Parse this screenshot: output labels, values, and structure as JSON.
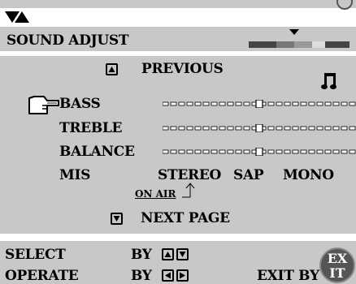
{
  "header": {
    "title": "SOUND ADJUST"
  },
  "menu": {
    "previous_label": "PREVIOUS",
    "next_label": "NEXT PAGE",
    "items": [
      {
        "label": "BASS"
      },
      {
        "label": "TREBLE"
      },
      {
        "label": "BALANCE"
      },
      {
        "label": "MIS"
      }
    ],
    "mis_options": [
      "STEREO",
      "SAP",
      "MONO"
    ],
    "on_air_label": "ON AIR"
  },
  "sliders": {
    "bass": 0.5,
    "treble": 0.5,
    "balance": 0.5
  },
  "footer": {
    "select_label": "SELECT",
    "select_by": "BY",
    "operate_label": "OPERATE",
    "operate_by": "BY",
    "exit_label": "EXIT BY",
    "exit_badge_top": "EX",
    "exit_badge_bottom": "IT"
  },
  "icons": {
    "top_arrows": "down-up-arrows-icon",
    "music": "music-note-icon",
    "pointer": "hand-pointer-icon",
    "up_button": "up-button-icon",
    "down_button": "down-button-icon",
    "left_button": "left-button-icon",
    "right_button": "right-button-icon",
    "exit_button": "exit-button-icon"
  }
}
